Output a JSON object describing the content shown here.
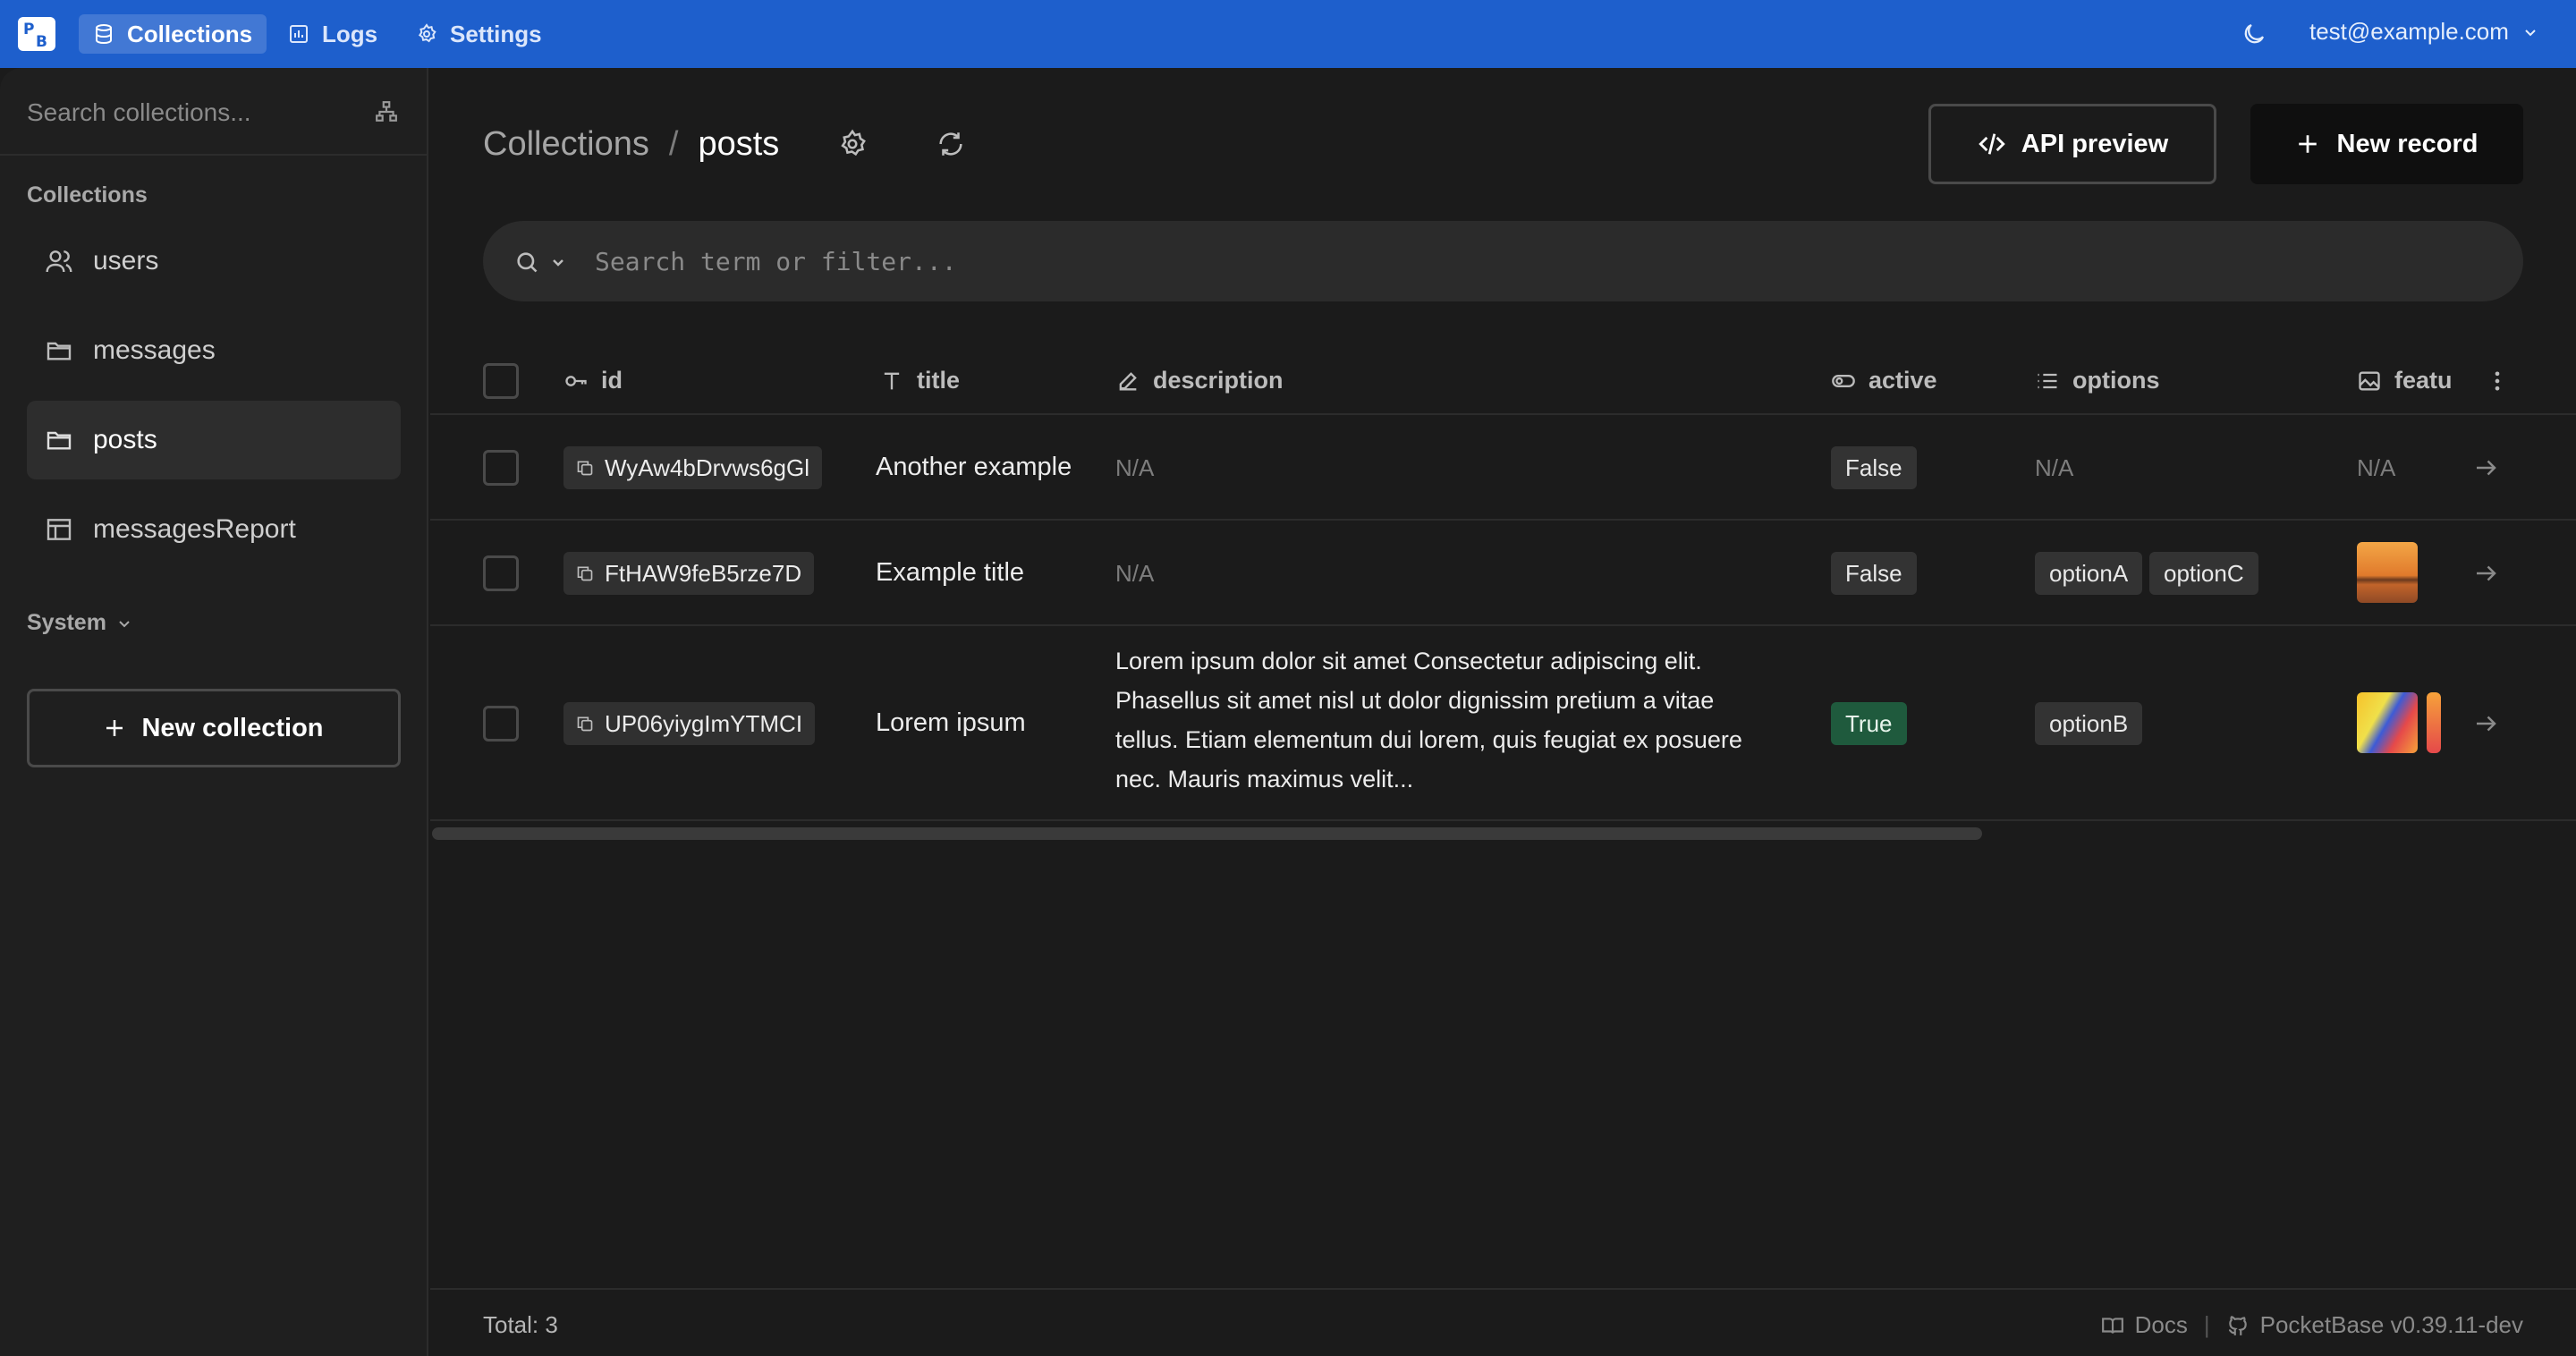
{
  "nav": {
    "items": [
      {
        "label": "Collections",
        "icon": "database-icon",
        "active": true
      },
      {
        "label": "Logs",
        "icon": "chart-icon",
        "active": false
      },
      {
        "label": "Settings",
        "icon": "gear-icon",
        "active": false
      }
    ],
    "user_email": "test@example.com"
  },
  "sidebar": {
    "search_placeholder": "Search collections...",
    "section_label": "Collections",
    "items": [
      {
        "label": "users",
        "icon": "users-icon"
      },
      {
        "label": "messages",
        "icon": "folder-icon"
      },
      {
        "label": "posts",
        "icon": "folder-icon",
        "active": true
      },
      {
        "label": "messagesReport",
        "icon": "table-icon"
      }
    ],
    "system_label": "System",
    "new_collection_label": "New collection"
  },
  "header": {
    "crumb_root": "Collections",
    "crumb_sep": "/",
    "crumb_current": "posts",
    "api_preview_label": "API preview",
    "new_record_label": "New record"
  },
  "search": {
    "placeholder": "Search term or filter..."
  },
  "table": {
    "columns": [
      "id",
      "title",
      "description",
      "active",
      "options",
      "featu"
    ],
    "rows": [
      {
        "id": "WyAw4bDrvws6gGl",
        "title": "Another example",
        "description": "N/A",
        "active": "False",
        "options": [],
        "options_text": "N/A",
        "featured": "N/A"
      },
      {
        "id": "FtHAW9feB5rze7D",
        "title": "Example title",
        "description": "N/A",
        "active": "False",
        "options": [
          "optionA",
          "optionC"
        ]
      },
      {
        "id": "UP06yiygImYTMCI",
        "title": "Lorem ipsum",
        "description_lines": [
          "Lorem ipsum dolor sit amet Consectetur adipiscing elit.",
          "Phasellus sit amet nisl ut dolor dignissim pretium a vitae",
          "tellus. Etiam elementum dui lorem, quis feugiat ex posuere",
          "nec. Mauris maximus velit..."
        ],
        "active": "True",
        "options": [
          "optionB"
        ]
      }
    ]
  },
  "footer": {
    "total": "Total: 3",
    "docs_label": "Docs",
    "divider": "|",
    "version_label": "PocketBase v0.39.11-dev"
  },
  "colors": {
    "topbar": "#1e5fcc",
    "true_badge": "#1f5a3d"
  }
}
